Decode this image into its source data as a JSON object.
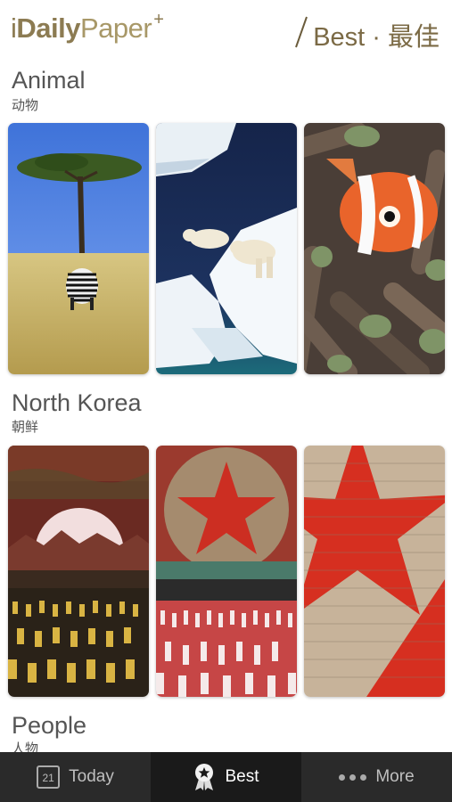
{
  "header": {
    "logo_i": "i",
    "logo_daily": "Daily",
    "logo_paper": "Paper",
    "logo_plus": "+",
    "title": "Best · 最佳"
  },
  "sections": [
    {
      "title": "Animal",
      "subtitle": "动物"
    },
    {
      "title": "North Korea",
      "subtitle": "朝鲜"
    },
    {
      "title": "People",
      "subtitle": "人物"
    }
  ],
  "tabs": [
    {
      "label": "Today",
      "icon": "calendar-icon",
      "calendar_day": "21"
    },
    {
      "label": "Best",
      "icon": "badge-star-icon"
    },
    {
      "label": "More",
      "icon": "more-dots-icon"
    }
  ],
  "colors": {
    "brand_gold": "#8c7b52",
    "tabbar_bg": "#2a2a2a",
    "tab_active_bg": "#1a1a1a"
  }
}
